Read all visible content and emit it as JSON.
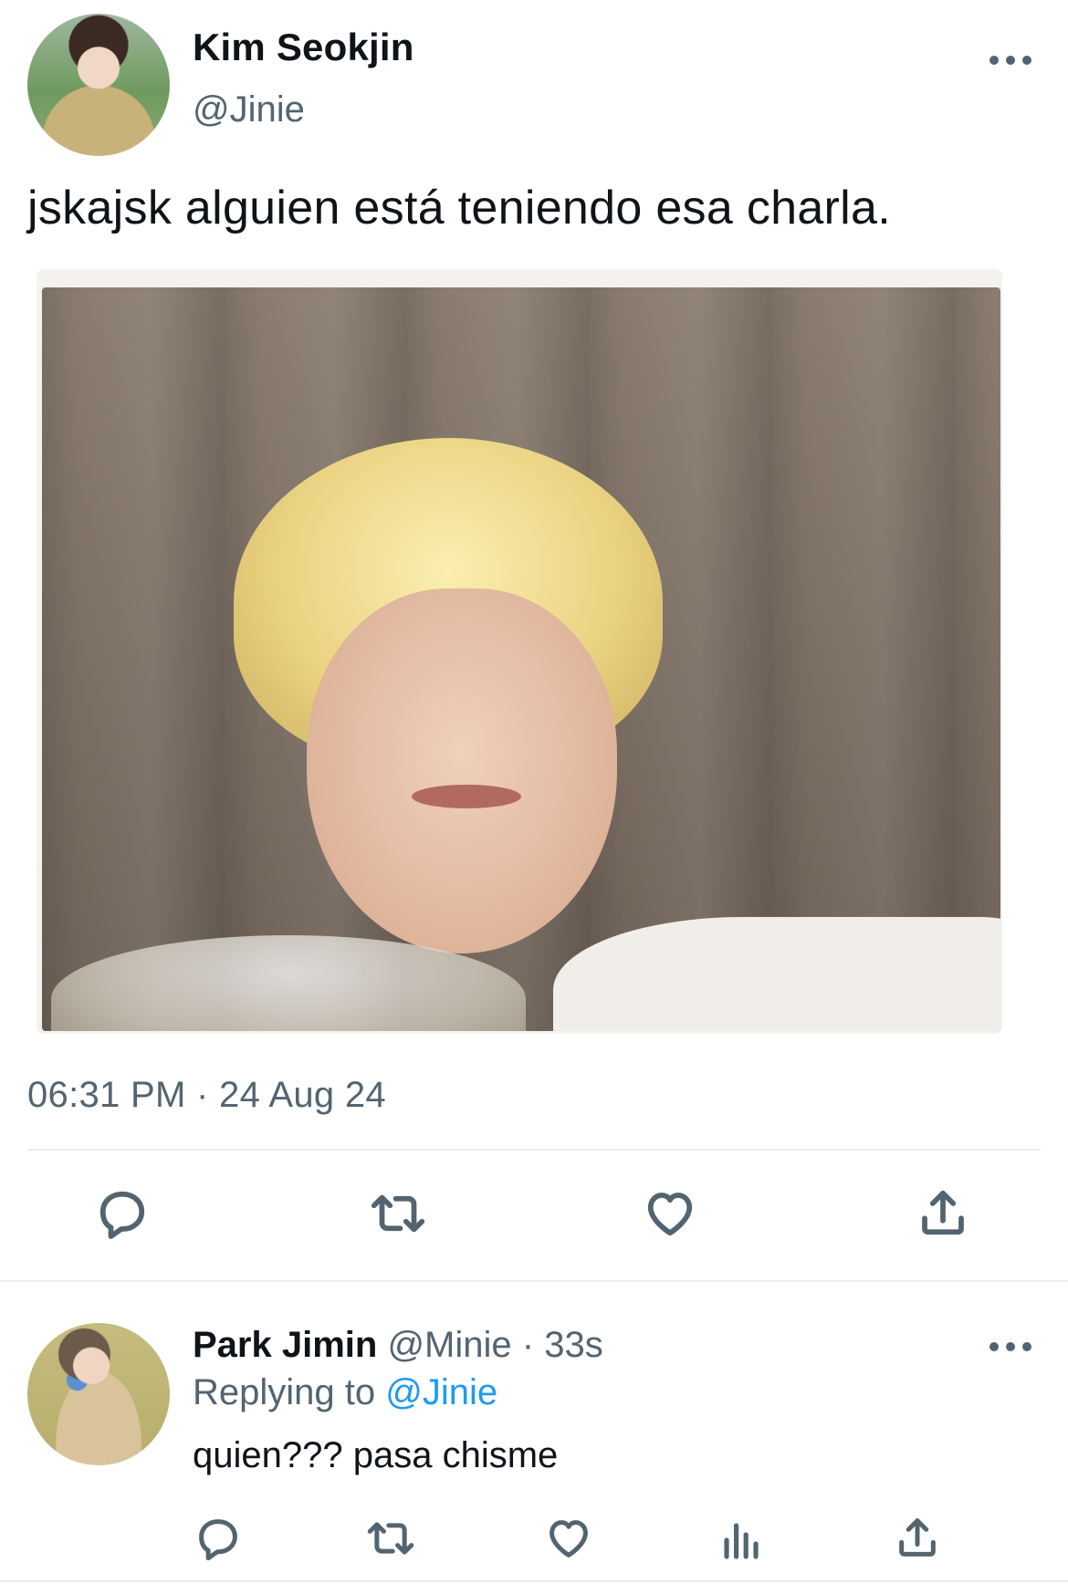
{
  "main_tweet": {
    "author": {
      "display_name": "Kim Seokjin",
      "handle": "@Jinie"
    },
    "text": "jskajsk alguien está teniendo esa charla.",
    "timestamp": "06:31 PM · 24 Aug 24",
    "actions": [
      "reply-icon",
      "retweet-icon",
      "like-icon",
      "share-icon"
    ]
  },
  "reply_tweet": {
    "author": {
      "display_name": "Park Jimin",
      "handle": "@Minie"
    },
    "separator": "·",
    "age": "33s",
    "replying_to_label": "Replying to",
    "replying_to_handle": "@Jinie",
    "text": "quien??? pasa chisme",
    "actions": [
      "reply-icon",
      "retweet-icon",
      "like-icon",
      "views-icon",
      "share-icon"
    ]
  },
  "colors": {
    "text_primary": "#0f1419",
    "text_secondary": "#536471",
    "mention": "#1d9bf0",
    "divider": "#e6ecf0"
  }
}
